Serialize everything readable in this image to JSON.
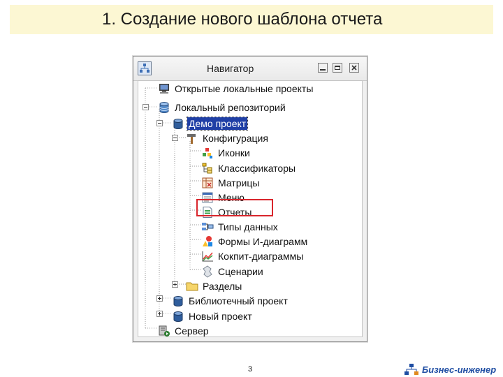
{
  "slide": {
    "title": "1. Создание нового шаблона отчета",
    "page_number": "3",
    "brand": "Бизнес-инженер"
  },
  "window": {
    "title": "Навигатор",
    "controls": [
      "minimize",
      "restore",
      "close"
    ]
  },
  "tree": {
    "items": [
      {
        "label": "Открытые локальные проекты",
        "icon": "computer-icon"
      },
      {
        "label": "Локальный репозиторий",
        "icon": "database-icon",
        "expanded": true
      },
      {
        "label": "Демо проект",
        "icon": "project-database-icon",
        "expanded": true,
        "selected": true
      },
      {
        "label": "Конфигурация",
        "icon": "hammer-icon",
        "expanded": true
      },
      {
        "label": "Иконки",
        "icon": "icons-icon"
      },
      {
        "label": "Классификаторы",
        "icon": "classifiers-icon"
      },
      {
        "label": "Матрицы",
        "icon": "matrix-icon"
      },
      {
        "label": "Меню",
        "icon": "menu-icon"
      },
      {
        "label": "Отчеты",
        "icon": "report-icon",
        "highlighted": true
      },
      {
        "label": "Типы данных",
        "icon": "data-types-icon"
      },
      {
        "label": "Формы И-диаграмм",
        "icon": "shapes-icon"
      },
      {
        "label": "Кокпит-диаграммы",
        "icon": "chart-icon"
      },
      {
        "label": "Сценарии",
        "icon": "scenario-icon"
      },
      {
        "label": "Разделы",
        "icon": "folder-icon",
        "expanded": false
      },
      {
        "label": "Библиотечный проект",
        "icon": "project-database-icon",
        "expanded": false
      },
      {
        "label": "Новый проект",
        "icon": "project-database-icon",
        "expanded": false
      },
      {
        "label": "Сервер",
        "icon": "server-icon"
      }
    ]
  },
  "colors": {
    "title_background": "#fcf7d3",
    "selection": "#1f3fa6",
    "highlight_border": "#d9262c",
    "brand": "#1f4ea3"
  }
}
